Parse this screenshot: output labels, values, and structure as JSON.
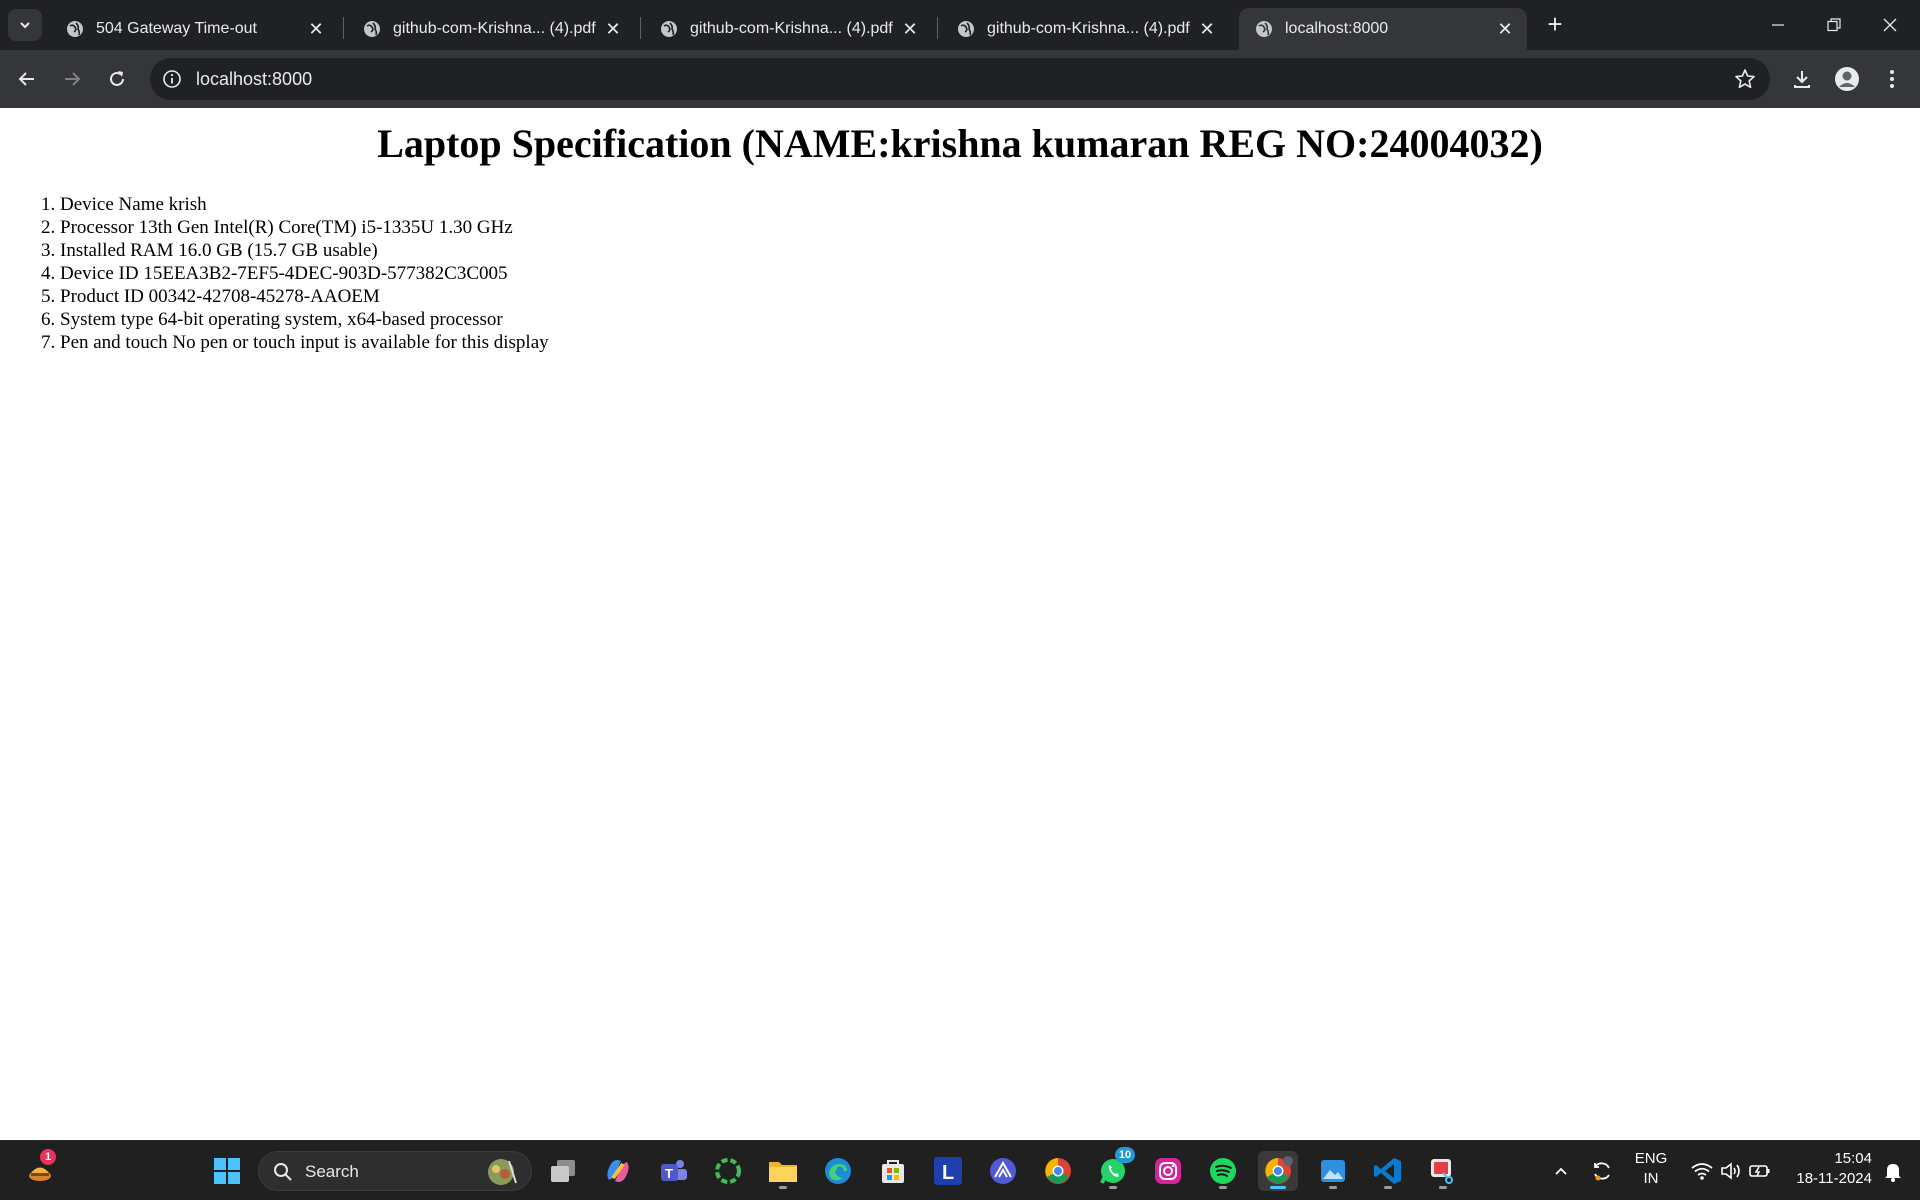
{
  "browser": {
    "tabs": [
      {
        "title": "504 Gateway Time-out",
        "active": false
      },
      {
        "title": "github-com-Krishna... (4).pdf",
        "active": false
      },
      {
        "title": "github-com-Krishna... (4).pdf",
        "active": false
      },
      {
        "title": "github-com-Krishna... (4).pdf",
        "active": false
      },
      {
        "title": "localhost:8000",
        "active": true
      }
    ],
    "new_tab_label": "+",
    "close_glyph": "✕",
    "address": "localhost:8000",
    "icons": {
      "tab_search": "chevron-down-icon",
      "back": "back-arrow-icon",
      "forward": "forward-arrow-icon",
      "reload": "reload-icon",
      "site_info": "info-icon",
      "bookmark": "star-icon",
      "downloads": "download-icon",
      "profile": "profile-icon",
      "menu": "more-vert-icon"
    }
  },
  "page": {
    "heading": "Laptop Specification (NAME:krishna kumaran REG NO:24004032)",
    "specs": [
      "Device Name krish",
      "Processor 13th Gen Intel(R) Core(TM) i5-1335U 1.30 GHz",
      "Installed RAM 16.0 GB (15.7 GB usable)",
      "Device ID 15EEA3B2-7EF5-4DEC-903D-577382C3C005",
      "Product ID 00342-42708-45278-AAOEM",
      "System type 64-bit operating system, x64-based processor",
      "Pen and touch No pen or touch input is available for this display"
    ]
  },
  "taskbar": {
    "weather_badge": "1",
    "search_label": "Search",
    "whatsapp_badge": "10",
    "language": "ENG",
    "region": "IN",
    "time": "15:04",
    "date": "18-11-2024",
    "accent_color": "#4cc2ff"
  }
}
